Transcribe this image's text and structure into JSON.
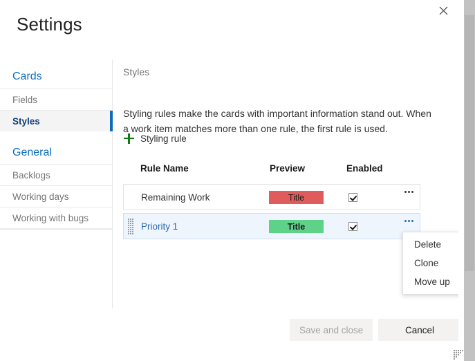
{
  "header": {
    "title": "Settings",
    "close_icon": "close-icon"
  },
  "sidebar": {
    "groups": [
      {
        "title": "Cards",
        "items": [
          {
            "label": "Fields",
            "selected": false
          },
          {
            "label": "Styles",
            "selected": true
          }
        ]
      },
      {
        "title": "General",
        "items": [
          {
            "label": "Backlogs",
            "selected": false
          },
          {
            "label": "Working days",
            "selected": false
          },
          {
            "label": "Working with bugs",
            "selected": false
          }
        ]
      }
    ]
  },
  "content": {
    "heading": "Styles",
    "description": "Styling rules make the cards with important information stand out. When a work item matches more than one rule, the first rule is used.",
    "add_rule_label": "Styling rule",
    "add_rule_icon": "plus-icon",
    "table": {
      "columns": [
        "Rule Name",
        "Preview",
        "Enabled"
      ],
      "rows": [
        {
          "name": "Remaining Work",
          "preview_text": "Title",
          "preview_color": "#e05c5c",
          "preview_bold": false,
          "enabled": true,
          "selected": false,
          "more_icon": "more-horizontal-icon"
        },
        {
          "name": "Priority 1",
          "preview_text": "Title",
          "preview_color": "#5fd28a",
          "preview_bold": true,
          "enabled": true,
          "selected": true,
          "more_icon": "more-horizontal-icon"
        }
      ]
    }
  },
  "context_menu": {
    "items": [
      "Delete",
      "Clone",
      "Move up"
    ]
  },
  "footer": {
    "save_label": "Save and close",
    "cancel_label": "Cancel"
  },
  "colors": {
    "accent": "#0f6cbd",
    "link": "#106ebe",
    "plus_green": "#107c10",
    "selected_row_bg": "#eff5fd"
  }
}
